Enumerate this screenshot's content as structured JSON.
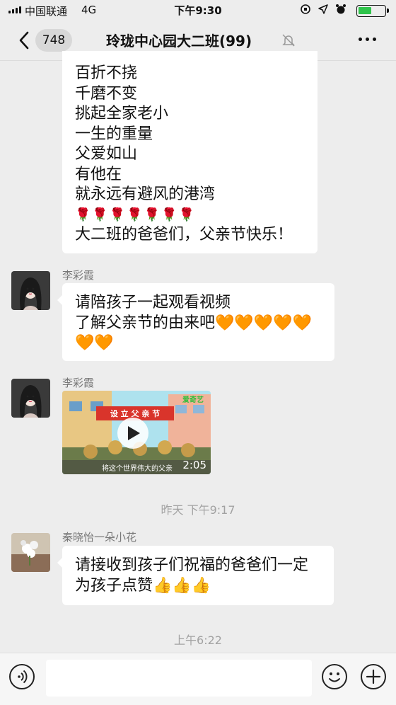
{
  "status_bar": {
    "carrier": "中国联通",
    "network": "4G",
    "time": "下午9:30",
    "battery_color": "#2fc44b"
  },
  "nav": {
    "back_count": "748",
    "title": "玲珑中心园大二班(99)",
    "icons": [
      "back-chevron-icon",
      "mute-bell-icon",
      "more-dots-icon"
    ]
  },
  "messages": [
    {
      "type": "text",
      "lines": [
        "百折不挠",
        "千磨不变",
        "挑起全家老小",
        "一生的重量",
        "父爱如山",
        "有他在",
        "就永远有避风的港湾",
        "🌹🌹🌹🌹🌹🌹🌹",
        "大二班的爸爸们，父亲节快乐！"
      ]
    },
    {
      "type": "text",
      "sender": "李彩霞",
      "lines": [
        "请陪孩子一起观看视频",
        "了解父亲节的由来吧🧡🧡🧡🧡🧡",
        "🧡🧡"
      ]
    },
    {
      "type": "video",
      "sender": "李彩霞",
      "banner_text": "设 立 父 亲 节",
      "subtitle": "将这个世界伟大的父亲",
      "logo": "爱奇艺",
      "duration": "2:05"
    },
    {
      "type": "timestamp",
      "text": "昨天 下午9:17"
    },
    {
      "type": "text",
      "sender": "秦晓怡一朵小花",
      "lines": [
        "请接收到孩子们祝福的爸爸们一定",
        "为孩子点赞👍👍👍"
      ]
    },
    {
      "type": "timestamp",
      "text": "上午6:22"
    }
  ],
  "input_bar": {
    "placeholder": "",
    "icons": [
      "voice-icon",
      "emoji-icon",
      "plus-icon"
    ]
  }
}
